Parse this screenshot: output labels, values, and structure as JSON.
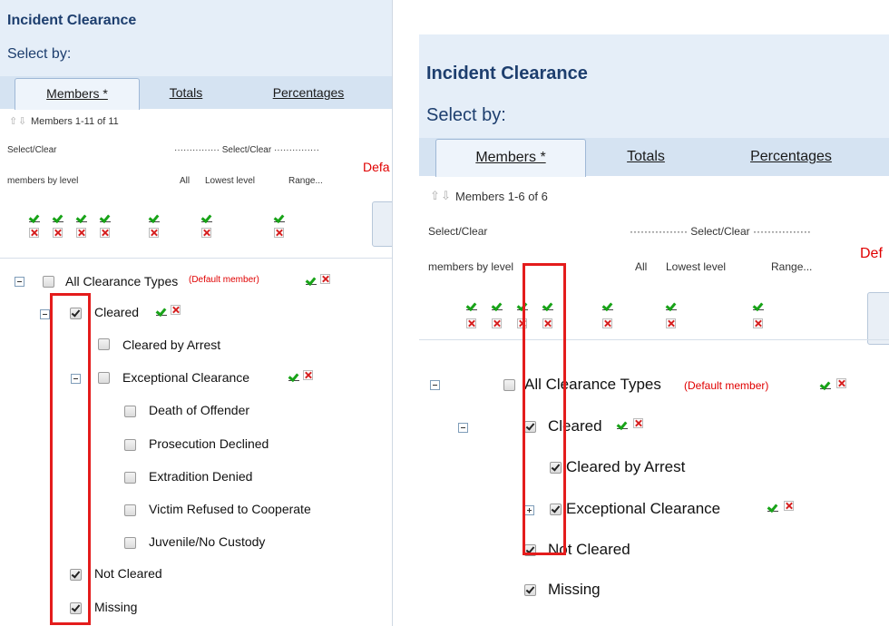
{
  "left": {
    "title": "Incident Clearance",
    "select_by": "Select by:",
    "tabs": [
      "Members *",
      "Totals",
      "Percentages"
    ],
    "members_count": "Members 1-11 of 11",
    "select_clear": "Select/Clear",
    "members_by_level": "members by level",
    "select_clear_dotted": "··············· Select/Clear ···············",
    "col_all": "All",
    "col_lowest": "Lowest level",
    "col_range": "Range...",
    "default_fragment": "Defa",
    "tree": [
      {
        "label": "All Clearance Types",
        "default_tag": "(Default member)",
        "checked": false
      },
      {
        "label": "Cleared",
        "checked": true
      },
      {
        "label": "Cleared by Arrest",
        "checked": false
      },
      {
        "label": "Exceptional Clearance",
        "checked": false
      },
      {
        "label": "Death of Offender",
        "checked": false
      },
      {
        "label": "Prosecution Declined",
        "checked": false
      },
      {
        "label": "Extradition Denied",
        "checked": false
      },
      {
        "label": "Victim Refused to Cooperate",
        "checked": false
      },
      {
        "label": "Juvenile/No Custody",
        "checked": false
      },
      {
        "label": "Not Cleared",
        "checked": true
      },
      {
        "label": "Missing",
        "checked": true
      }
    ]
  },
  "right": {
    "title": "Incident Clearance",
    "select_by": "Select by:",
    "tabs": [
      "Members *",
      "Totals",
      "Percentages"
    ],
    "members_count": "Members 1-6 of 6",
    "select_clear": "Select/Clear",
    "members_by_level": "members by level",
    "select_clear_dotted": "················ Select/Clear ················",
    "col_all": "All",
    "col_lowest": "Lowest level",
    "col_range": "Range...",
    "default_fragment": "Def",
    "tree": [
      {
        "label": "All Clearance Types",
        "default_tag": "(Default member)",
        "checked": false
      },
      {
        "label": "Cleared",
        "checked": true
      },
      {
        "label": "Cleared by Arrest",
        "checked": true
      },
      {
        "label": "Exceptional Clearance",
        "checked": true
      },
      {
        "label": "Not Cleared",
        "checked": true
      },
      {
        "label": "Missing",
        "checked": true
      }
    ]
  },
  "icons": {
    "up_arrow": "⇧",
    "down_arrow": "⇩"
  },
  "colors": {
    "title": "#1d3e6e",
    "highlight": "#e41c1c",
    "check_green": "#18a318",
    "clear_red": "#d62020",
    "default_tag": "#e00000"
  }
}
